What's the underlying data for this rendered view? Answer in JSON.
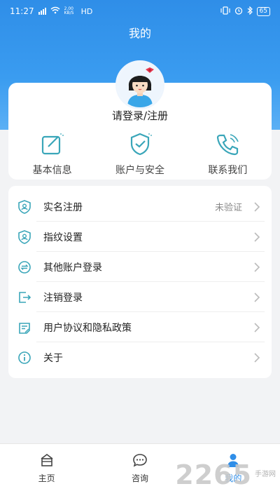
{
  "status_bar": {
    "time": "11:27",
    "net_speed": "2.00 KB/S",
    "hd": "HD",
    "battery": "65"
  },
  "header": {
    "title": "我的"
  },
  "profile": {
    "login_text": "请登录/注册"
  },
  "quick_actions": [
    {
      "label": "基本信息",
      "icon": "edit-icon"
    },
    {
      "label": "账户与安全",
      "icon": "shield-check-icon"
    },
    {
      "label": "联系我们",
      "icon": "phone-icon"
    }
  ],
  "menu": [
    {
      "label": "实名注册",
      "value": "未验证",
      "icon": "id-shield-icon"
    },
    {
      "label": "指纹设置",
      "icon": "fingerprint-shield-icon"
    },
    {
      "label": "其他账户登录",
      "icon": "switch-account-icon"
    },
    {
      "label": "注销登录",
      "icon": "logout-icon"
    },
    {
      "label": "用户协议和隐私政策",
      "icon": "agreement-icon"
    },
    {
      "label": "关于",
      "icon": "info-icon"
    }
  ],
  "tabbar": [
    {
      "label": "主页",
      "icon": "home-icon"
    },
    {
      "label": "咨询",
      "icon": "chat-icon"
    },
    {
      "label": "我的",
      "icon": "user-icon",
      "active": true
    }
  ],
  "watermark": {
    "number": "2265",
    "text": "手游网"
  },
  "colors": {
    "primary": "#2f8ee8",
    "background": "#f2f3f5",
    "icon_teal": "#3aa6b9"
  }
}
